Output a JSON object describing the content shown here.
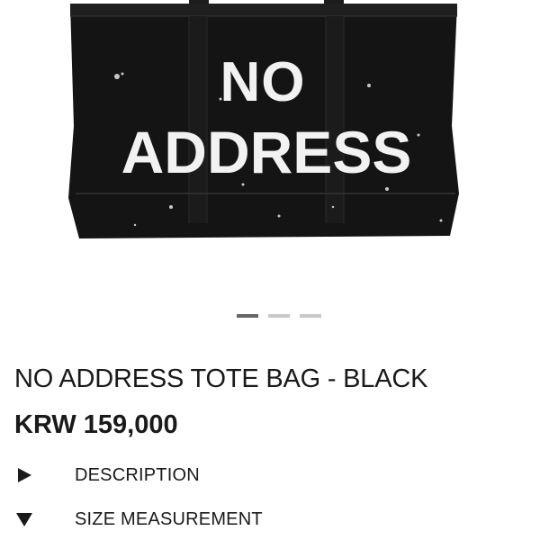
{
  "product": {
    "title": "NO ADDRESS TOTE BAG - BLACK",
    "price": "KRW 159,000",
    "image_text_line1": "NO",
    "image_text_line2": "ADDRESS",
    "image_alt": "Black canvas tote bag with painted white NO ADDRESS lettering"
  },
  "carousel": {
    "total": 3,
    "active_index": 0
  },
  "sections": [
    {
      "label": "DESCRIPTION",
      "icon": "caret-right-icon",
      "expanded": false
    },
    {
      "label": "SIZE MEASUREMENT",
      "icon": "caret-down-icon",
      "expanded": true
    }
  ],
  "colors": {
    "text": "#1a1a1a",
    "dot_active": "#666666",
    "dot_inactive": "#c8c8c8",
    "bag": "#141414"
  }
}
